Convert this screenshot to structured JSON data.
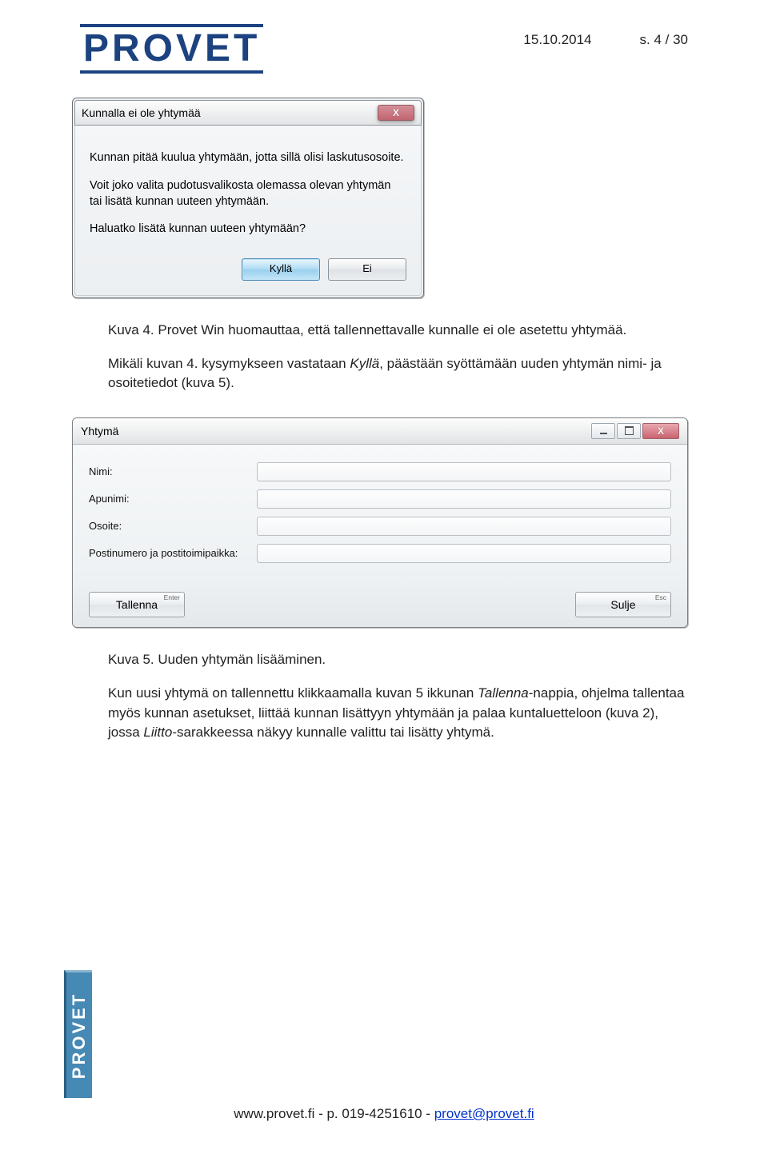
{
  "header": {
    "logo": "PROVET",
    "date": "15.10.2014",
    "page": "s. 4 / 30"
  },
  "dialog1": {
    "title": "Kunnalla ei ole yhtymää",
    "line1": "Kunnan pitää kuulua yhtymään, jotta sillä olisi laskutusosoite.",
    "line2a": "Voit joko valita pudotusvalikosta olemassa olevan yhtymän",
    "line2b": "tai lisätä kunnan uuteen yhtymään.",
    "line3": "Haluatko lisätä kunnan uuteen yhtymään?",
    "yes": "Kyllä",
    "no": "Ei",
    "close_x": "X"
  },
  "caption1": "Kuva 4. Provet Win huomauttaa, että tallennettavalle kunnalle ei ole asetettu yhtymää.",
  "para1_a": "Mikäli kuvan 4. kysymykseen vastataan ",
  "para1_i": "Kyllä",
  "para1_b": ", päästään syöttämään uuden yhtymän nimi- ja osoitetiedot (kuva 5).",
  "dialog2": {
    "title": "Yhtymä",
    "label_nimi": "Nimi:",
    "label_apunimi": "Apunimi:",
    "label_osoite": "Osoite:",
    "label_posti": "Postinumero ja postitoimipaikka:",
    "btn_save": "Tallenna",
    "hint_save": "Enter",
    "btn_close": "Sulje",
    "hint_close": "Esc",
    "close_x": "X"
  },
  "caption2": "Kuva 5. Uuden yhtymän lisääminen.",
  "para2_a": "Kun uusi yhtymä on tallennettu klikkaamalla kuvan 5 ikkunan ",
  "para2_i1": "Tallenna",
  "para2_c": "-nappia, ohjelma tallentaa myös kunnan asetukset, liittää kunnan lisättyyn yhtymään ja palaa kuntaluetteloon (kuva 2), jossa ",
  "para2_i2": "Liitto",
  "para2_d": "-sarakkeessa näkyy kunnalle valittu tai lisätty yhtymä.",
  "footer": {
    "website": "www.provet.fi",
    "sep1": " - p. ",
    "phone": "019-4251610",
    "sep2": "   -   ",
    "email": "provet@provet.fi"
  },
  "side": "PROVET"
}
